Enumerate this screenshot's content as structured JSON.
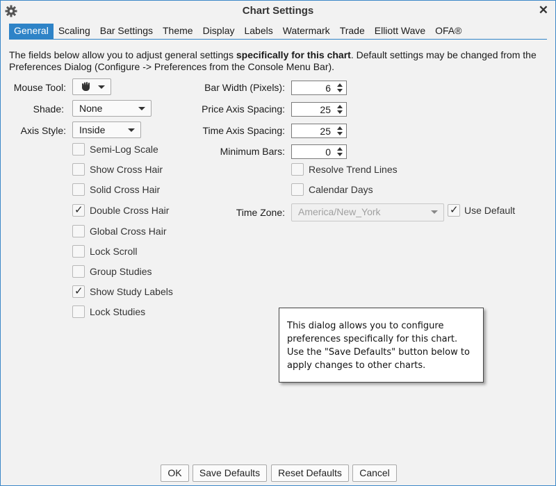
{
  "window": {
    "title": "Chart Settings",
    "accent_color": "#2e83c7",
    "icons": {
      "settings": "gear-icon",
      "close": "close-icon"
    },
    "close_glyph": "✕"
  },
  "tabs": [
    {
      "label": "General",
      "active": true
    },
    {
      "label": "Scaling"
    },
    {
      "label": "Bar Settings"
    },
    {
      "label": "Theme"
    },
    {
      "label": "Display"
    },
    {
      "label": "Labels"
    },
    {
      "label": "Watermark"
    },
    {
      "label": "Trade"
    },
    {
      "label": "Elliott Wave"
    },
    {
      "label": "OFA®"
    }
  ],
  "description": {
    "part1": "The fields below allow you to adjust general settings ",
    "bold": "specifically for this chart",
    "part2": ".  Default settings may be changed from the Preferences Dialog (Configure -> Preferences from the Console Menu Bar)."
  },
  "left": {
    "mouse_tool": {
      "label": "Mouse Tool:",
      "icon": "hand-icon"
    },
    "shade": {
      "label": "Shade:",
      "value": "None"
    },
    "axis_style": {
      "label": "Axis Style:",
      "value": "Inside"
    },
    "checkboxes": [
      {
        "label": "Semi-Log Scale",
        "checked": false
      },
      {
        "label": "Show Cross Hair",
        "checked": false
      },
      {
        "label": "Solid Cross Hair",
        "checked": false
      },
      {
        "label": "Double Cross Hair",
        "checked": true
      },
      {
        "label": "Global Cross Hair",
        "checked": false
      },
      {
        "label": "Lock Scroll",
        "checked": false
      },
      {
        "label": "Group Studies",
        "checked": false
      },
      {
        "label": "Show Study Labels",
        "checked": true
      },
      {
        "label": "Lock Studies",
        "checked": false
      }
    ]
  },
  "right": {
    "bar_width": {
      "label": "Bar Width (Pixels):",
      "value": "6"
    },
    "price_axis_spacing": {
      "label": "Price Axis Spacing:",
      "value": "25"
    },
    "time_axis_spacing": {
      "label": "Time Axis Spacing:",
      "value": "25"
    },
    "minimum_bars": {
      "label": "Minimum Bars:",
      "value": "0"
    },
    "resolve_trend_lines": {
      "label": "Resolve Trend Lines",
      "checked": false
    },
    "calendar_days": {
      "label": "Calendar Days",
      "checked": false
    },
    "time_zone": {
      "label": "Time Zone:",
      "value": "America/New_York",
      "disabled": true
    },
    "use_default": {
      "label": "Use Default",
      "checked": true
    }
  },
  "tooltip": {
    "text": "This dialog allows you to configure preferences specifically for this chart. Use the \"Save Defaults\" button below to apply changes to other charts."
  },
  "check_glyph": "✓",
  "buttons": {
    "ok": "OK",
    "save_defaults": "Save Defaults",
    "reset_defaults": "Reset Defaults",
    "cancel": "Cancel"
  }
}
